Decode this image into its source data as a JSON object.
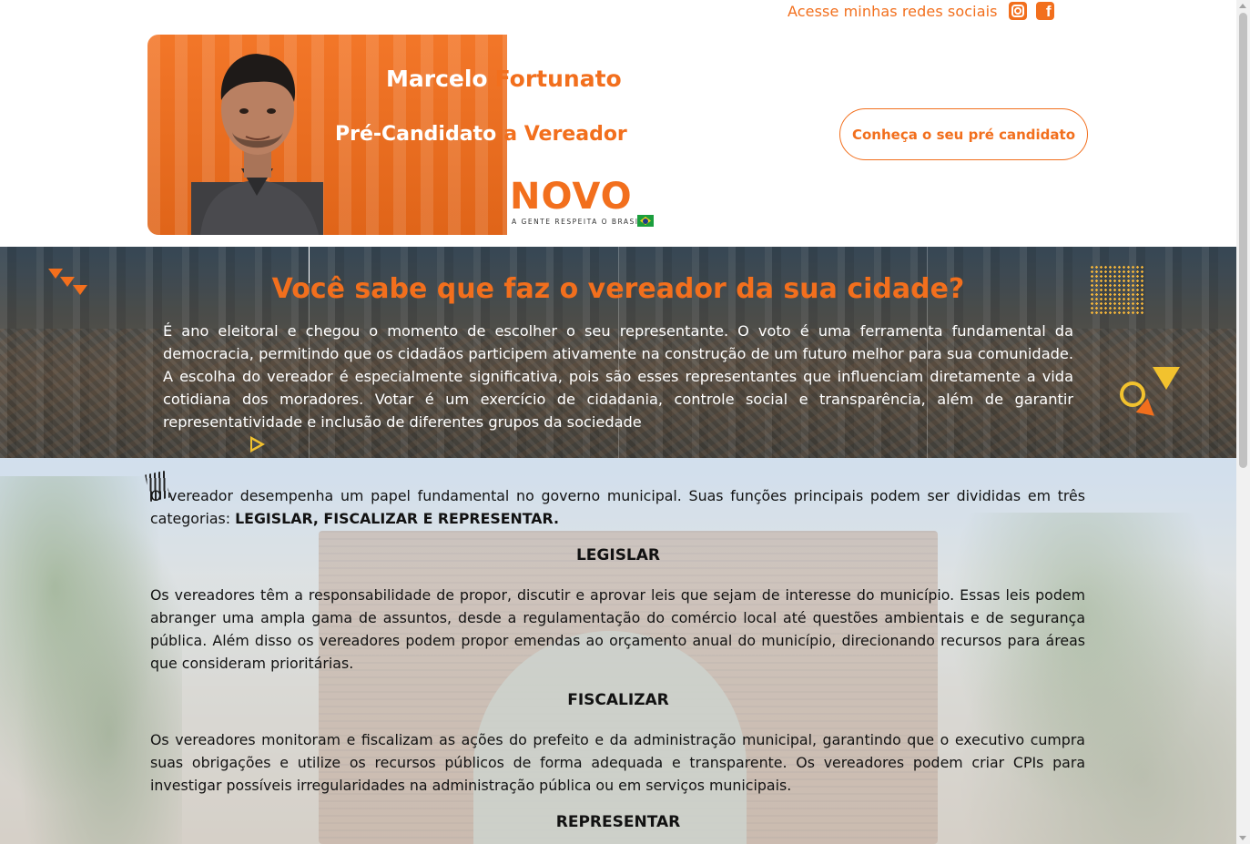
{
  "header": {
    "social_label": "Acesse minhas redes sociais",
    "social_icons": [
      "instagram-icon",
      "facebook-icon"
    ],
    "cta_label": "Conheça o seu pré candidato"
  },
  "banner": {
    "first_name": "Marcelo",
    "last_name": "Fortunato",
    "role_a": "Pré-Candidato",
    "role_b": "a Vereador",
    "party": "NOVO",
    "party_tagline": "A GENTE RESPEITA O BRASIL"
  },
  "hero": {
    "title": "Você sabe que faz o vereador da sua cidade?",
    "text": "É ano eleitoral e chegou o momento de escolher o seu representante. O voto é uma ferramenta fundamental da democracia, permitindo que os cidadãos participem ativamente na construção de um futuro melhor para sua comunidade. A escolha do vereador é especialmente significativa, pois são esses representantes que influenciam diretamente a vida cotidiana dos moradores. Votar é um exercício de cidadania, controle social e transparência, além de garantir representatividade e inclusão de diferentes grupos da sociedade"
  },
  "content": {
    "intro": "O vereador desempenha um papel fundamental no governo municipal. Suas funções principais podem ser divididas em três categorias: ",
    "intro_bold": "LEGISLAR, FISCALIZAR E REPRESENTAR.",
    "sections": [
      {
        "heading": "LEGISLAR",
        "text": "Os vereadores têm a responsabilidade de propor, discutir e aprovar leis que sejam de interesse do município. Essas leis podem abranger uma ampla gama de assuntos, desde a regulamentação do comércio local até questões ambientais e de segurança pública. Além disso os vereadores podem propor emendas ao orçamento anual do município, direcionando recursos para áreas que consideram prioritárias."
      },
      {
        "heading": "FISCALIZAR",
        "text": "Os vereadores monitoram e fiscalizam as ações do prefeito e da administração municipal, garantindo que o executivo cumpra suas obrigações e utilize os recursos públicos de forma adequada e transparente. Os vereadores podem criar CPIs para investigar possíveis irregularidades na administração pública ou em serviços municipais."
      },
      {
        "heading": "REPRESENTAR",
        "text": ""
      }
    ]
  },
  "colors": {
    "accent": "#f26f1d",
    "yellow": "#f2c22e",
    "text_dark": "#121212"
  }
}
